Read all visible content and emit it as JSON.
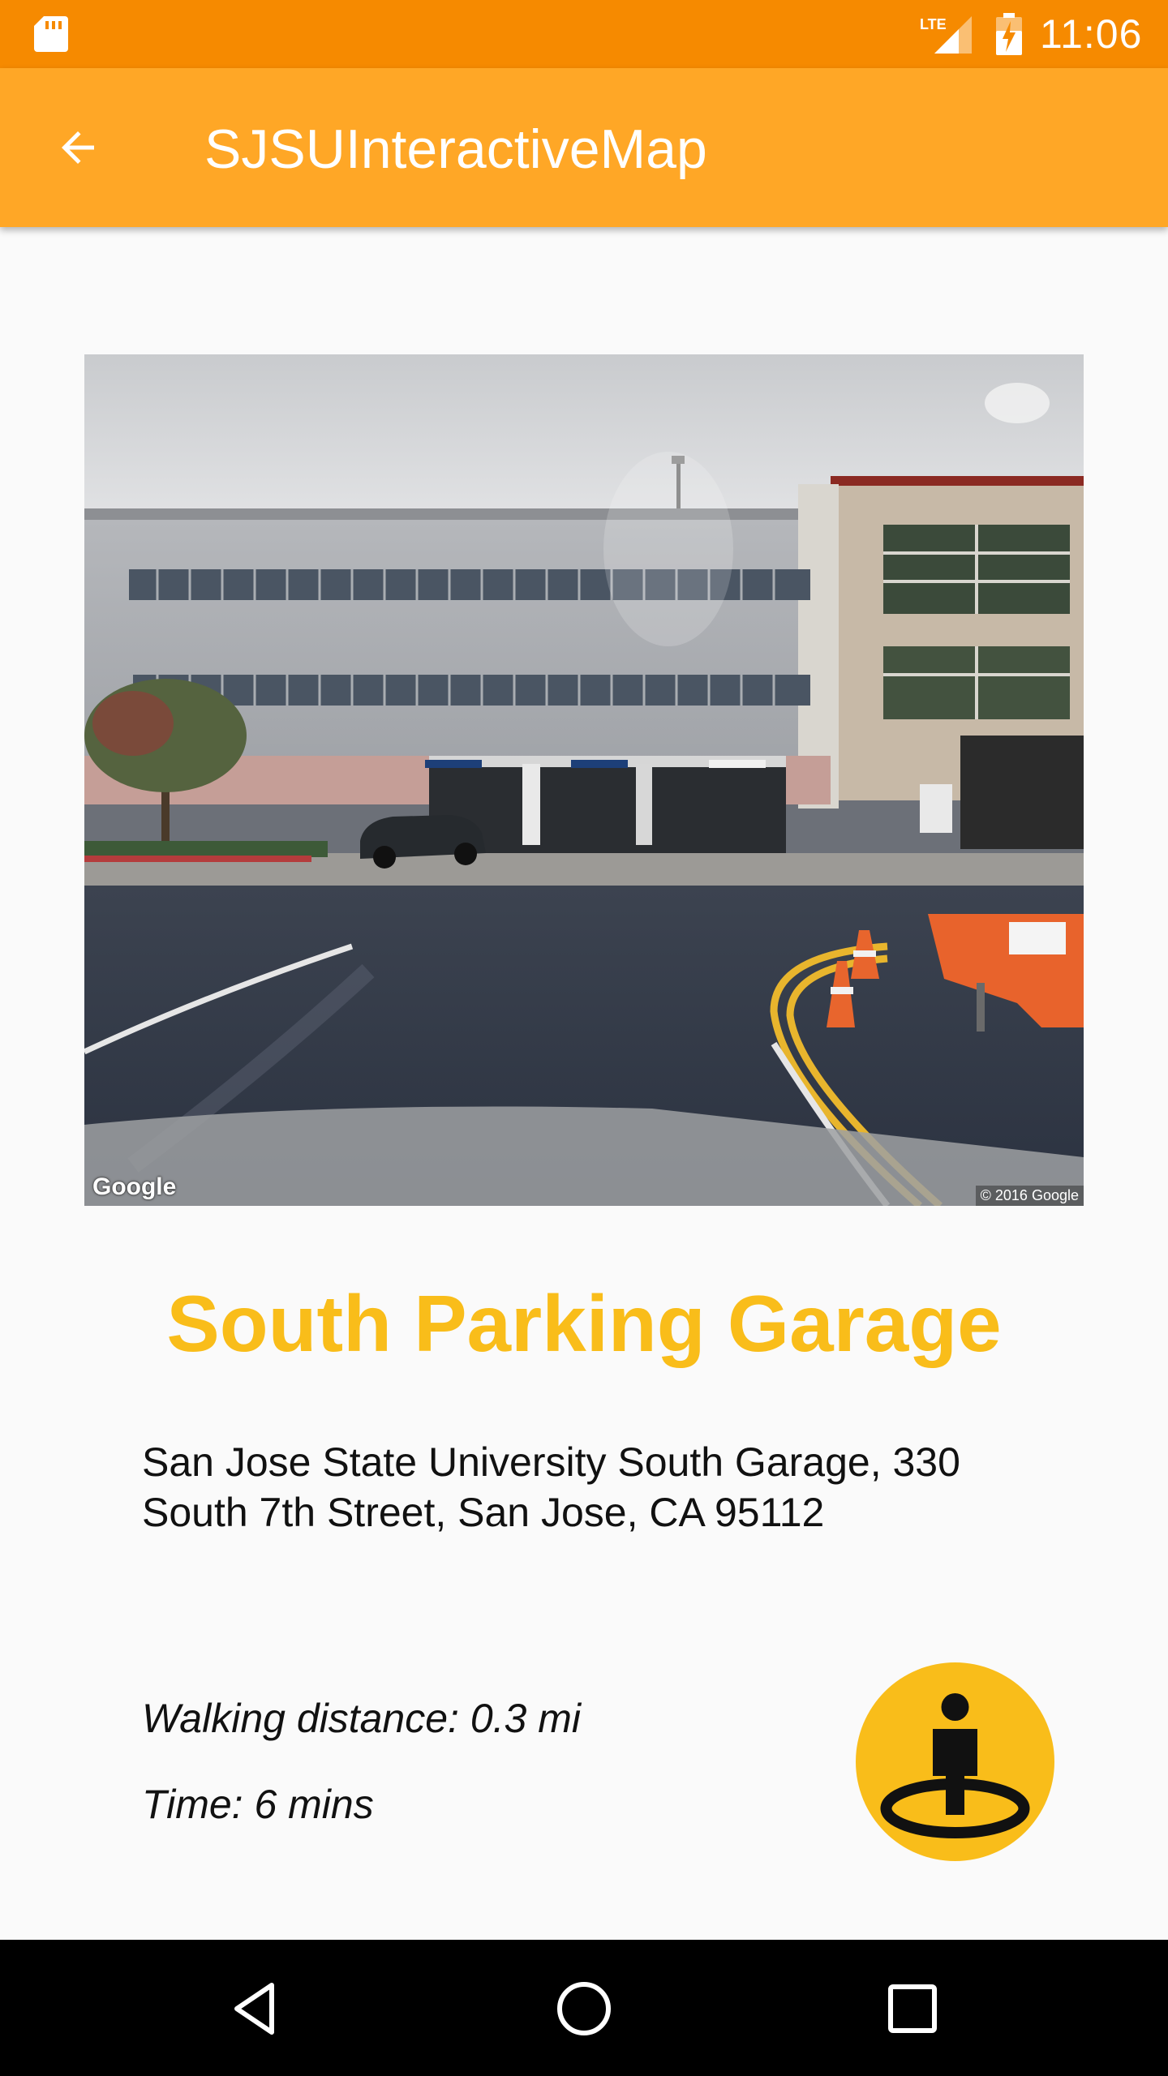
{
  "status_bar": {
    "time": "11:06",
    "network": "LTE",
    "icons": [
      "sd-card-icon",
      "lte-signal-icon",
      "battery-charging-icon"
    ]
  },
  "app_bar": {
    "title": "SJSUInteractiveMap",
    "back_icon": "arrow-back-icon"
  },
  "street_view": {
    "attribution_left": "Google",
    "attribution_right": "© 2016 Google"
  },
  "place": {
    "name": "South Parking Garage",
    "address": "San Jose State University South Garage, 330 South 7th Street, San Jose, CA 95112"
  },
  "walking": {
    "distance": "Walking distance: 0.3 mi",
    "time": "Time: 6 mins"
  },
  "fab": {
    "icon": "street-view-person-icon"
  },
  "nav_bar": {
    "icons": [
      "nav-back-icon",
      "nav-home-icon",
      "nav-recents-icon"
    ]
  },
  "colors": {
    "status_bar": "#f68a00",
    "app_bar": "#ffa726",
    "accent": "#f9bd1a",
    "background": "#fafafa",
    "nav_bar": "#000000"
  }
}
